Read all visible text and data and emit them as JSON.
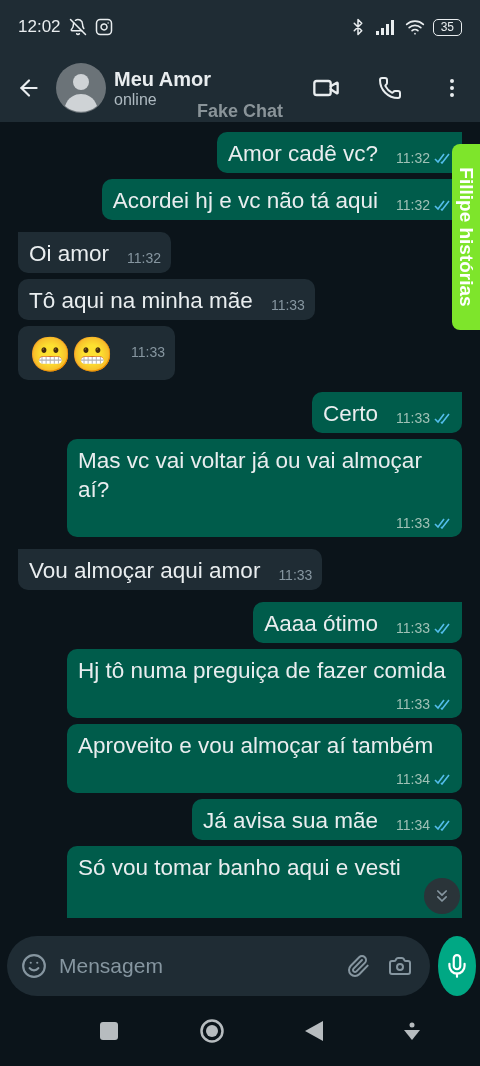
{
  "status_bar": {
    "time": "12:02",
    "battery": "35"
  },
  "header": {
    "name": "Meu Amor",
    "status": "online"
  },
  "overlay_label": "Fake Chat",
  "side_tag": "Fillipe histórias",
  "messages": [
    {
      "kind": "text",
      "outgoing": true,
      "text": "Amor cadê vc?",
      "time": "11:32",
      "read": true,
      "tail": true
    },
    {
      "kind": "text",
      "outgoing": true,
      "text": "Acordei hj e vc não tá aqui",
      "time": "11:32",
      "read": true,
      "tail": false
    },
    {
      "kind": "text",
      "outgoing": false,
      "text": "Oi amor",
      "time": "11:32",
      "tail": true
    },
    {
      "kind": "text",
      "outgoing": false,
      "text": "Tô aqui na minha mãe",
      "time": "11:33",
      "tail": false
    },
    {
      "kind": "emoji",
      "outgoing": false,
      "text": "😬😬",
      "time": "11:33",
      "tail": false
    },
    {
      "kind": "text",
      "outgoing": true,
      "text": "Certo",
      "time": "11:33",
      "read": true,
      "tail": true
    },
    {
      "kind": "text",
      "outgoing": true,
      "text": "Mas vc vai voltar já ou vai almoçar aí?",
      "time": "11:33",
      "read": true,
      "tail": false
    },
    {
      "kind": "text",
      "outgoing": false,
      "text": "Vou almoçar aqui amor",
      "time": "11:33",
      "tail": true
    },
    {
      "kind": "text",
      "outgoing": true,
      "text": "Aaaa ótimo",
      "time": "11:33",
      "read": true,
      "tail": true
    },
    {
      "kind": "text",
      "outgoing": true,
      "text": "Hj tô numa preguiça de fazer comida",
      "time": "11:33",
      "read": true,
      "tail": false
    },
    {
      "kind": "text",
      "outgoing": true,
      "text": "Aproveito e vou almoçar aí também",
      "time": "11:34",
      "read": true,
      "tail": false
    },
    {
      "kind": "text",
      "outgoing": true,
      "text": "Já avisa sua mãe",
      "time": "11:34",
      "read": true,
      "tail": false
    },
    {
      "kind": "partial",
      "outgoing": true,
      "text": "Só vou tomar banho aqui e vesti",
      "tail": false
    }
  ],
  "composer": {
    "placeholder": "Mensagem"
  }
}
